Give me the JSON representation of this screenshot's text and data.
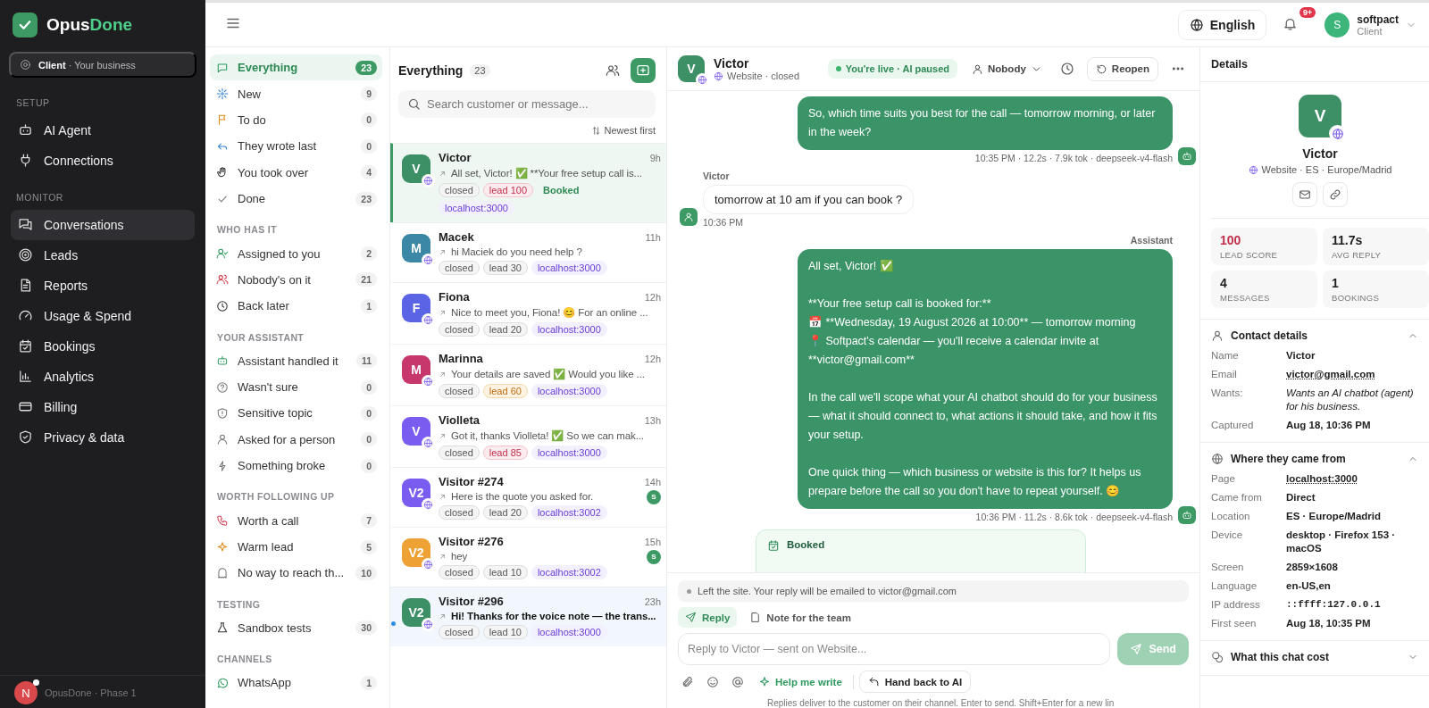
{
  "sidebar": {
    "logo": {
      "first": "Opus",
      "second": "Done"
    },
    "workspace": {
      "role": "Client",
      "name": "· Your business"
    },
    "sections": [
      {
        "heading": "SETUP",
        "items": [
          {
            "label": "AI Agent",
            "selected": false
          },
          {
            "label": "Connections",
            "selected": false
          }
        ]
      },
      {
        "heading": "MONITOR",
        "items": [
          {
            "label": "Conversations",
            "selected": true
          },
          {
            "label": "Leads",
            "selected": false
          },
          {
            "label": "Reports",
            "selected": false
          },
          {
            "label": "Usage & Spend",
            "selected": false
          },
          {
            "label": "Bookings",
            "selected": false
          },
          {
            "label": "Analytics",
            "selected": false
          },
          {
            "label": "Billing",
            "selected": false
          },
          {
            "label": "Privacy & data",
            "selected": false
          }
        ]
      }
    ],
    "footer": {
      "avatar": "N",
      "label": "OpusDone · Phase 1"
    }
  },
  "topbar": {
    "language": "English",
    "notifications": "9+",
    "user": {
      "initial": "S",
      "name": "softpact",
      "role": "Client"
    }
  },
  "filters": [
    {
      "items": [
        {
          "label": "Everything",
          "count": "23",
          "selected": true
        },
        {
          "label": "New",
          "count": "9",
          "selected": false
        },
        {
          "label": "To do",
          "count": "0",
          "selected": false
        },
        {
          "label": "They wrote last",
          "count": "0",
          "selected": false
        },
        {
          "label": "You took over",
          "count": "4",
          "selected": false
        },
        {
          "label": "Done",
          "count": "23",
          "selected": false
        }
      ]
    },
    {
      "heading": "WHO HAS IT",
      "items": [
        {
          "label": "Assigned to you",
          "count": "2",
          "selected": false
        },
        {
          "label": "Nobody's on it",
          "count": "21",
          "selected": false
        },
        {
          "label": "Back later",
          "count": "1",
          "selected": false
        }
      ]
    },
    {
      "heading": "YOUR ASSISTANT",
      "items": [
        {
          "label": "Assistant handled it",
          "count": "11",
          "selected": false
        },
        {
          "label": "Wasn't sure",
          "count": "0",
          "selected": false
        },
        {
          "label": "Sensitive topic",
          "count": "0",
          "selected": false
        },
        {
          "label": "Asked for a person",
          "count": "0",
          "selected": false
        },
        {
          "label": "Something broke",
          "count": "0",
          "selected": false
        }
      ]
    },
    {
      "heading": "WORTH FOLLOWING UP",
      "items": [
        {
          "label": "Worth a call",
          "count": "7",
          "selected": false
        },
        {
          "label": "Warm lead",
          "count": "5",
          "selected": false
        },
        {
          "label": "No way to reach th...",
          "count": "10",
          "selected": false
        }
      ]
    },
    {
      "heading": "TESTING",
      "items": [
        {
          "label": "Sandbox tests",
          "count": "30",
          "selected": false
        }
      ]
    },
    {
      "heading": "CHANNELS",
      "items": [
        {
          "label": "WhatsApp",
          "count": "1",
          "selected": false
        }
      ]
    }
  ],
  "list": {
    "title": "Everything",
    "count": "23",
    "search": {
      "placeholder": "Search customer or message..."
    },
    "sort": "Newest first",
    "conversations": [
      {
        "initial": "V",
        "color": "#3d8f66",
        "name": "Victor",
        "time": "9h",
        "preview": "All set, Victor! ✅ **Your free setup call is...",
        "selected": true,
        "unread": false,
        "tags": [
          {
            "label": "closed",
            "kind": "status"
          },
          {
            "label": "lead 100",
            "kind": "lead-hot"
          },
          {
            "label": "Booked",
            "kind": "booked"
          },
          {
            "label": "localhost:3000",
            "kind": "source"
          }
        ]
      },
      {
        "initial": "M",
        "color": "#3a87a6",
        "name": "Macek",
        "time": "11h",
        "preview": "hi Maciek do you need help ?",
        "selected": false,
        "unread": false,
        "tags": [
          {
            "label": "closed",
            "kind": "status"
          },
          {
            "label": "lead 30",
            "kind": "lead"
          },
          {
            "label": "localhost:3000",
            "kind": "source"
          }
        ]
      },
      {
        "initial": "F",
        "color": "#5a64e4",
        "name": "Fiona",
        "time": "12h",
        "preview": "Nice to meet you, Fiona! 😊 For an online ...",
        "selected": false,
        "unread": false,
        "tags": [
          {
            "label": "closed",
            "kind": "status"
          },
          {
            "label": "lead 20",
            "kind": "lead"
          },
          {
            "label": "localhost:3000",
            "kind": "source"
          }
        ]
      },
      {
        "initial": "M",
        "color": "#c7376c",
        "name": "Marinna",
        "time": "12h",
        "preview": "Your details are saved ✅ Would you like ...",
        "selected": false,
        "unread": false,
        "tags": [
          {
            "label": "closed",
            "kind": "status"
          },
          {
            "label": "lead 60",
            "kind": "lead-warm"
          },
          {
            "label": "localhost:3000",
            "kind": "source"
          }
        ]
      },
      {
        "initial": "V",
        "color": "#7a5cf0",
        "name": "Violleta",
        "time": "13h",
        "preview": "Got it, thanks Violleta! ✅ So we can mak...",
        "selected": false,
        "unread": false,
        "tags": [
          {
            "label": "closed",
            "kind": "status"
          },
          {
            "label": "lead 85",
            "kind": "lead-hot"
          },
          {
            "label": "localhost:3000",
            "kind": "source"
          }
        ]
      },
      {
        "initial": "V2",
        "color": "#7a5cf0",
        "name": "Visitor #274",
        "time": "14h",
        "preview": "Here is the quote you asked for.",
        "assignee": "S",
        "selected": false,
        "unread": false,
        "tags": [
          {
            "label": "closed",
            "kind": "status"
          },
          {
            "label": "lead 20",
            "kind": "lead"
          },
          {
            "label": "localhost:3002",
            "kind": "source"
          }
        ]
      },
      {
        "initial": "V2",
        "color": "#eea235",
        "name": "Visitor #276",
        "time": "15h",
        "preview": "hey",
        "assignee": "S",
        "selected": false,
        "unread": false,
        "tags": [
          {
            "label": "closed",
            "kind": "status"
          },
          {
            "label": "lead 10",
            "kind": "lead"
          },
          {
            "label": "localhost:3002",
            "kind": "source"
          }
        ]
      },
      {
        "initial": "V2",
        "color": "#3d8f66",
        "name": "Visitor #296",
        "time": "23h",
        "preview": "Hi! Thanks for the voice note — the trans...",
        "selected": false,
        "unread": true,
        "tags": [
          {
            "label": "closed",
            "kind": "status"
          },
          {
            "label": "lead 10",
            "kind": "lead"
          },
          {
            "label": "localhost:3000",
            "kind": "source"
          }
        ]
      }
    ]
  },
  "chat": {
    "contact": {
      "initial": "V",
      "name": "Victor",
      "meta": "Website · closed"
    },
    "status": "You're live · AI paused",
    "assignee": "Nobody",
    "reopen": "Reopen",
    "messages": [
      {
        "kind": "assistant",
        "text": "So, which time suits you best for the call — tomorrow morning, or later in the week?",
        "meta": "10:35 PM · 12.2s · 7.9k tok · deepseek-v4-flash"
      },
      {
        "kind": "customer",
        "sender": "Victor",
        "text": "tomorrow at 10 am if you can book ?",
        "time": "10:36 PM"
      },
      {
        "kind": "assistant",
        "sender": "Assistant",
        "text": "All set, Victor! ✅\n\n**Your free setup call is booked for:**\n📅 **Wednesday, 19 August 2026 at 10:00** — tomorrow morning\n📍 Softpact's calendar — you'll receive a calendar invite at **victor@gmail.com**\n\nIn the call we'll scope what your AI chatbot should do for your business — what it should connect to, what actions it should take, and how it fits your setup.\n\nOne quick thing — which business or website is this for? It helps us prepare before the call so you don't have to repeat yourself. 😊",
        "meta": "10:36 PM · 11.2s · 8.6k tok · deepseek-v4-flash"
      },
      {
        "kind": "booking",
        "title": "Booked"
      }
    ],
    "notice": "Left the site. Your reply will be emailed to victor@gmail.com",
    "tabs": [
      {
        "label": "Reply",
        "selected": true
      },
      {
        "label": "Note for the team",
        "selected": false
      }
    ],
    "input": {
      "placeholder": "Reply to Victor — sent on Website..."
    },
    "send": {
      "label": "Send",
      "disabled": true
    },
    "help": "Help me write",
    "handback": "Hand back to AI",
    "hint": "Replies deliver to the customer on their channel. Enter to send. Shift+Enter for a new lin"
  },
  "details": {
    "title": "Details",
    "profile": {
      "initial": "V",
      "name": "Victor",
      "meta": "Website · ES · Europe/Madrid"
    },
    "stats": [
      {
        "value": "100",
        "label": "LEAD SCORE",
        "kind": "score"
      },
      {
        "value": "11.7s",
        "label": "AVG REPLY",
        "kind": "plain"
      },
      {
        "value": "4",
        "label": "MESSAGES",
        "kind": "plain"
      },
      {
        "value": "1",
        "label": "BOOKINGS",
        "kind": "plain"
      }
    ],
    "sections": [
      {
        "title": "Contact details",
        "expanded": true,
        "rows": [
          {
            "label": "Name",
            "value": "Victor",
            "kind": "text"
          },
          {
            "label": "Email",
            "value": "victor@gmail.com",
            "kind": "link"
          },
          {
            "label": "Wants:",
            "value": "Wants an AI chatbot (agent) for his business.",
            "kind": "note"
          },
          {
            "label": "Captured",
            "value": "Aug 18, 10:36 PM",
            "kind": "text"
          }
        ]
      },
      {
        "title": "Where they came from",
        "expanded": true,
        "rows": [
          {
            "label": "Page",
            "value": "localhost:3000",
            "kind": "link"
          },
          {
            "label": "Came from",
            "value": "Direct",
            "kind": "text"
          },
          {
            "label": "Location",
            "value": "ES · Europe/Madrid",
            "kind": "text"
          },
          {
            "label": "Device",
            "value": "desktop · Firefox 153 · macOS",
            "kind": "text"
          },
          {
            "label": "Screen",
            "value": "2859×1608",
            "kind": "text"
          },
          {
            "label": "Language",
            "value": "en-US,en",
            "kind": "text"
          },
          {
            "label": "IP address",
            "value": "::ffff:127.0.0.1",
            "kind": "mono"
          },
          {
            "label": "First seen",
            "value": "Aug 18, 10:35 PM",
            "kind": "text"
          }
        ]
      },
      {
        "title": "What this chat cost",
        "expanded": false
      }
    ]
  }
}
